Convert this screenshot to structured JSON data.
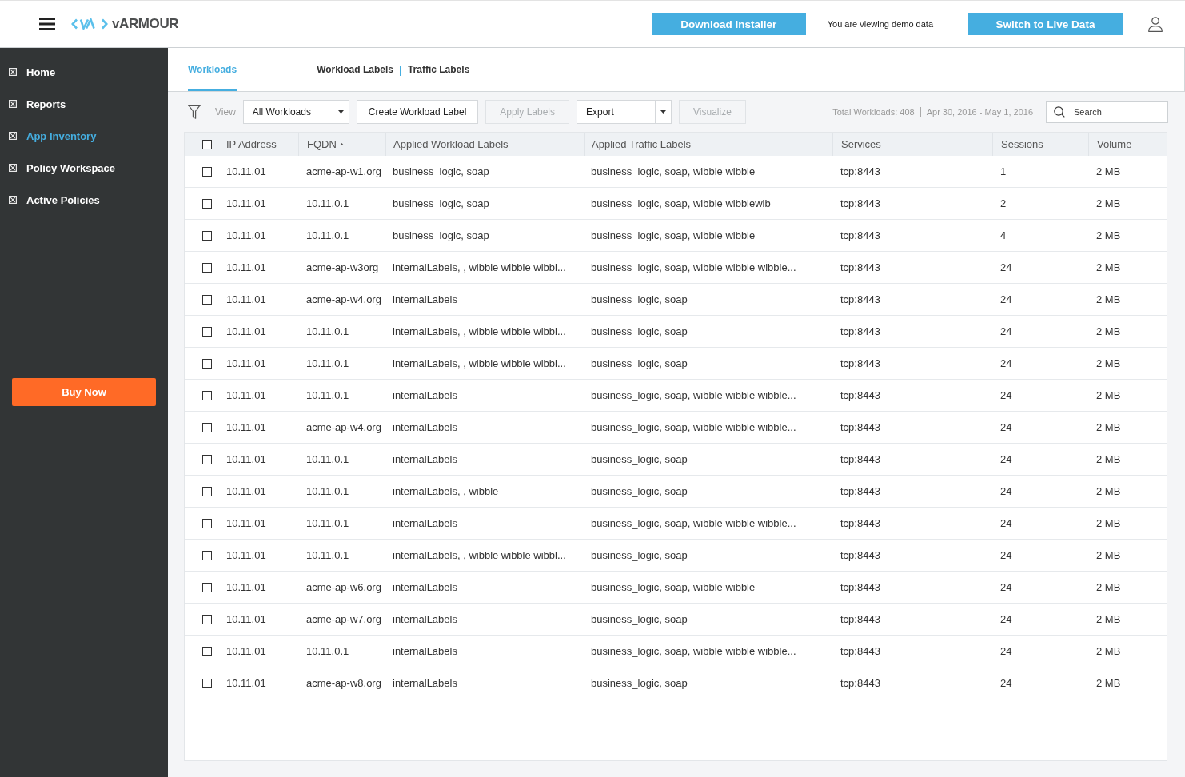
{
  "header": {
    "logo_text": "vARMOUR",
    "download_button": {
      "label": "Download Installer"
    },
    "demo_notice": "You are viewing demo data",
    "live_button": {
      "label": "Switch to Live Data"
    }
  },
  "sidebar": {
    "items": [
      {
        "label": "Home",
        "selected": false
      },
      {
        "label": "Reports",
        "selected": false
      },
      {
        "label": "App Inventory",
        "selected": true
      },
      {
        "label": "Policy Workspace",
        "selected": false
      },
      {
        "label": "Active Policies",
        "selected": false
      }
    ],
    "buy_button": {
      "label": "Buy Now"
    }
  },
  "tabs": [
    {
      "label": "Workloads",
      "selected": true
    },
    {
      "label": "Workload Labels",
      "selected": false
    },
    {
      "label": "Traffic Labels",
      "selected": false
    }
  ],
  "toolbar": {
    "view_label": "View",
    "view_select": {
      "value": "All Workloads"
    },
    "actions": [
      {
        "kind": "button",
        "label": "Create Workload Label",
        "disabled": false
      },
      {
        "kind": "button",
        "label": "Apply Labels",
        "disabled": true
      },
      {
        "kind": "dropdown",
        "label": "Export",
        "disabled": false
      },
      {
        "kind": "button",
        "label": "Visualize",
        "disabled": true
      }
    ],
    "total": "Total Workloads: 408",
    "date_range": "Apr 30, 2016 - May 1, 2016",
    "search": {
      "placeholder": "Search"
    }
  },
  "table": {
    "select_all": {
      "checked": false
    },
    "columns": [
      {
        "label": "IP Address",
        "sorted": false
      },
      {
        "label": "FQDN",
        "sorted": true
      },
      {
        "label": "Applied Workload Labels",
        "sorted": false
      },
      {
        "label": "Applied Traffic Labels",
        "sorted": false
      },
      {
        "label": "Services",
        "sorted": false
      },
      {
        "label": "Sessions",
        "sorted": false
      },
      {
        "label": "Volume",
        "sorted": false
      }
    ],
    "rows": [
      {
        "checked": false,
        "ip": "10.11.01",
        "fqdn": "acme-ap-w1.org",
        "workload_labels": "business_logic, soap",
        "traffic_labels": "business_logic, soap, wibble wibble",
        "services": "tcp:8443",
        "sessions": "1",
        "volume": "2 MB"
      },
      {
        "checked": false,
        "ip": "10.11.01",
        "fqdn": "10.11.0.1",
        "workload_labels": "business_logic, soap",
        "traffic_labels": "business_logic, soap, wibble wibblewib",
        "services": "tcp:8443",
        "sessions": "2",
        "volume": "2 MB"
      },
      {
        "checked": false,
        "ip": "10.11.01",
        "fqdn": "10.11.0.1",
        "workload_labels": "business_logic, soap",
        "traffic_labels": "business_logic, soap, wibble wibble",
        "services": "tcp:8443",
        "sessions": "4",
        "volume": "2 MB"
      },
      {
        "checked": false,
        "ip": "10.11.01",
        "fqdn": "acme-ap-w3org",
        "workload_labels": "internalLabels, , wibble wibble wibbl...",
        "traffic_labels": "business_logic, soap, wibble wibble wibble...",
        "services": "tcp:8443",
        "sessions": "24",
        "volume": "2 MB"
      },
      {
        "checked": false,
        "ip": "10.11.01",
        "fqdn": "acme-ap-w4.org",
        "workload_labels": "internalLabels",
        "traffic_labels": "business_logic, soap",
        "services": "tcp:8443",
        "sessions": "24",
        "volume": "2 MB"
      },
      {
        "checked": false,
        "ip": "10.11.01",
        "fqdn": "10.11.0.1",
        "workload_labels": "internalLabels, , wibble wibble wibbl...",
        "traffic_labels": "business_logic, soap",
        "services": "tcp:8443",
        "sessions": "24",
        "volume": "2 MB"
      },
      {
        "checked": false,
        "ip": "10.11.01",
        "fqdn": "10.11.0.1",
        "workload_labels": "internalLabels, , wibble wibble wibbl...",
        "traffic_labels": "business_logic, soap",
        "services": "tcp:8443",
        "sessions": "24",
        "volume": "2 MB"
      },
      {
        "checked": false,
        "ip": "10.11.01",
        "fqdn": "10.11.0.1",
        "workload_labels": "internalLabels",
        "traffic_labels": "business_logic, soap, wibble wibble wibble...",
        "services": "tcp:8443",
        "sessions": "24",
        "volume": "2 MB"
      },
      {
        "checked": false,
        "ip": "10.11.01",
        "fqdn": "acme-ap-w4.org",
        "workload_labels": "internalLabels",
        "traffic_labels": "business_logic, soap, wibble wibble wibble...",
        "services": "tcp:8443",
        "sessions": "24",
        "volume": "2 MB"
      },
      {
        "checked": false,
        "ip": "10.11.01",
        "fqdn": "10.11.0.1",
        "workload_labels": "internalLabels",
        "traffic_labels": "business_logic, soap",
        "services": "tcp:8443",
        "sessions": "24",
        "volume": "2 MB"
      },
      {
        "checked": false,
        "ip": "10.11.01",
        "fqdn": "10.11.0.1",
        "workload_labels": "internalLabels, , wibble",
        "traffic_labels": "business_logic, soap",
        "services": "tcp:8443",
        "sessions": "24",
        "volume": "2 MB"
      },
      {
        "checked": false,
        "ip": "10.11.01",
        "fqdn": "10.11.0.1",
        "workload_labels": "internalLabels",
        "traffic_labels": "business_logic, soap, wibble wibble wibble...",
        "services": "tcp:8443",
        "sessions": "24",
        "volume": "2 MB"
      },
      {
        "checked": false,
        "ip": "10.11.01",
        "fqdn": "10.11.0.1",
        "workload_labels": "internalLabels, , wibble wibble wibbl...",
        "traffic_labels": "business_logic, soap",
        "services": "tcp:8443",
        "sessions": "24",
        "volume": "2 MB"
      },
      {
        "checked": false,
        "ip": "10.11.01",
        "fqdn": "acme-ap-w6.org",
        "workload_labels": "internalLabels",
        "traffic_labels": "business_logic, soap, wibble wibble",
        "services": "tcp:8443",
        "sessions": "24",
        "volume": "2 MB"
      },
      {
        "checked": false,
        "ip": "10.11.01",
        "fqdn": "acme-ap-w7.org",
        "workload_labels": "internalLabels",
        "traffic_labels": "business_logic, soap",
        "services": "tcp:8443",
        "sessions": "24",
        "volume": "2 MB"
      },
      {
        "checked": false,
        "ip": "10.11.01",
        "fqdn": "10.11.0.1",
        "workload_labels": "internalLabels",
        "traffic_labels": "business_logic, soap, wibble wibble wibble...",
        "services": "tcp:8443",
        "sessions": "24",
        "volume": "2 MB"
      },
      {
        "checked": false,
        "ip": "10.11.01",
        "fqdn": "acme-ap-w8.org",
        "workload_labels": "internalLabels",
        "traffic_labels": "business_logic, soap",
        "services": "tcp:8443",
        "sessions": "24",
        "volume": "2 MB"
      }
    ]
  }
}
